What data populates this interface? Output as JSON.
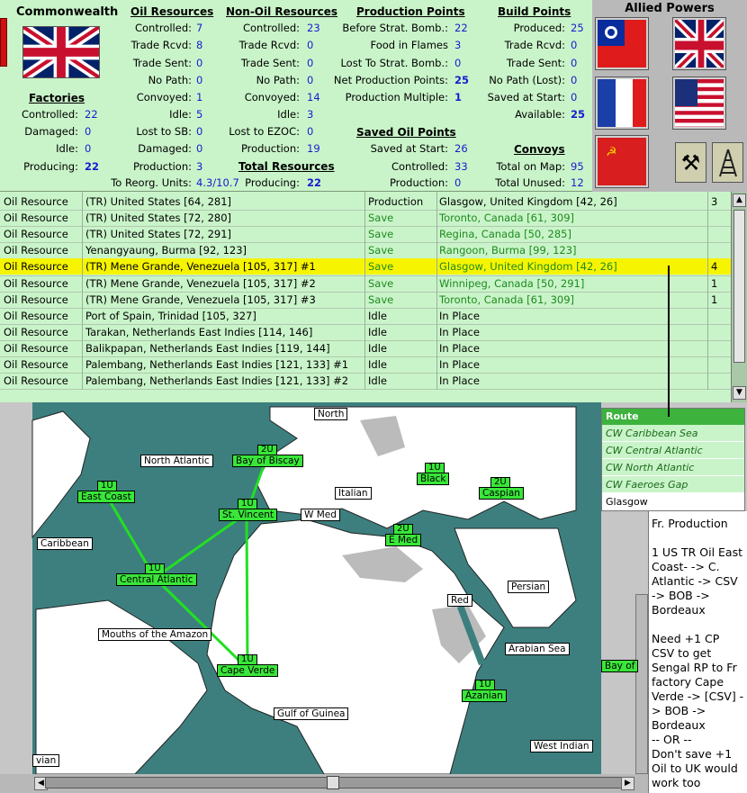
{
  "commonwealth": {
    "title": "Commonwealth"
  },
  "oil": {
    "heading": "Oil Resources",
    "controlled_l": "Controlled:",
    "controlled": "7",
    "trade_rcvd_l": "Trade Rcvd:",
    "trade_rcvd": "8",
    "trade_sent_l": "Trade Sent:",
    "trade_sent": "0",
    "no_path_l": "No Path:",
    "no_path": "0",
    "convoyed_l": "Convoyed:",
    "convoyed": "1",
    "idle_l": "Idle:",
    "idle": "5",
    "lost_sb_l": "Lost to SB:",
    "lost_sb": "0",
    "damaged_l": "Damaged:",
    "damaged": "0",
    "production_l": "Production:",
    "production": "3"
  },
  "factories": {
    "heading": "Factories",
    "controlled_l": "Controlled:",
    "controlled": "22",
    "damaged_l": "Damaged:",
    "damaged": "0",
    "idle_l": "Idle:",
    "idle": "0",
    "producing_l": "Producing:",
    "producing": "22"
  },
  "nonoil": {
    "heading": "Non-Oil Resources",
    "controlled_l": "Controlled:",
    "controlled": "23",
    "trade_rcvd_l": "Trade Rcvd:",
    "trade_rcvd": "0",
    "trade_sent_l": "Trade Sent:",
    "trade_sent": "0",
    "no_path_l": "No Path:",
    "no_path": "0",
    "convoyed_l": "Convoyed:",
    "convoyed": "14",
    "idle_l": "Idle:",
    "idle": "3",
    "lost_ezoc_l": "Lost to EZOC:",
    "lost_ezoc": "0",
    "production_l": "Production:",
    "production": "19"
  },
  "total": {
    "heading": "Total Resources",
    "reorg_l": "To Reorg. Units:",
    "reorg": "4.3/10.7",
    "producing_l": "Producing:",
    "producing": "22"
  },
  "pp": {
    "heading": "Production Points",
    "before_l": "Before Strat. Bomb.:",
    "before": "22",
    "food_l": "Food in Flames",
    "food": "3",
    "lost_l": "Lost To Strat. Bomb.:",
    "lost": "0",
    "net_l": "Net Production Points:",
    "net": "25",
    "mult_l": "Production Multiple:",
    "mult": "1"
  },
  "saved": {
    "heading": "Saved Oil Points",
    "start_l": "Saved at Start:",
    "start": "26",
    "controlled_l": "Controlled:",
    "controlled": "33",
    "production_l": "Production:",
    "production": "0"
  },
  "bp": {
    "heading": "Build Points",
    "produced_l": "Produced:",
    "produced": "25",
    "trade_rcvd_l": "Trade Rcvd:",
    "trade_rcvd": "0",
    "trade_sent_l": "Trade Sent:",
    "trade_sent": "0",
    "no_path_l": "No Path (Lost):",
    "no_path": "0",
    "saved_l": "Saved at Start:",
    "saved": "0",
    "available_l": "Available:",
    "available": "25"
  },
  "convoys": {
    "heading": "Convoys",
    "total_l": "Total on Map:",
    "total": "95",
    "unused_l": "Total Unused:",
    "unused": "12"
  },
  "allied": {
    "title": "Allied Powers"
  },
  "colors": {
    "panel_bg": "#c9f4c9",
    "value_blue": "#1a1ad0",
    "selected_row": "#f6f400",
    "save_green": "#1f8a1f",
    "sea": "#3d7f7f",
    "unit_green": "#39e639"
  },
  "rows": [
    {
      "type": "Oil Resource",
      "resource": "(TR) United States [64, 281]",
      "status": "Production",
      "dest": "Glasgow, United Kingdom [42, 26]",
      "num": "3",
      "save": false,
      "sel": false
    },
    {
      "type": "Oil Resource",
      "resource": "(TR) United States [72, 280]",
      "status": "Save",
      "dest": "Toronto, Canada [61, 309]",
      "num": "",
      "save": true,
      "sel": false
    },
    {
      "type": "Oil Resource",
      "resource": "(TR) United States [72, 291]",
      "status": "Save",
      "dest": "Regina, Canada [50, 285]",
      "num": "",
      "save": true,
      "sel": false
    },
    {
      "type": "Oil Resource",
      "resource": "Yenangyaung, Burma [92, 123]",
      "status": "Save",
      "dest": "Rangoon, Burma [99, 123]",
      "num": "",
      "save": true,
      "sel": false
    },
    {
      "type": "Oil Resource",
      "resource": "(TR) Mene Grande, Venezuela [105, 317] #1",
      "status": "Save",
      "dest": "Glasgow, United Kingdom [42, 26]",
      "num": "4",
      "save": true,
      "sel": true
    },
    {
      "type": "Oil Resource",
      "resource": "(TR) Mene Grande, Venezuela [105, 317] #2",
      "status": "Save",
      "dest": "Winnipeg, Canada [50, 291]",
      "num": "1",
      "save": true,
      "sel": false
    },
    {
      "type": "Oil Resource",
      "resource": "(TR) Mene Grande, Venezuela [105, 317] #3",
      "status": "Save",
      "dest": "Toronto, Canada [61, 309]",
      "num": "1",
      "save": true,
      "sel": false
    },
    {
      "type": "Oil Resource",
      "resource": "Port of Spain, Trinidad [105, 327]",
      "status": "Idle",
      "dest": "In Place",
      "num": "",
      "save": false,
      "sel": false
    },
    {
      "type": "Oil Resource",
      "resource": "Tarakan, Netherlands East Indies [114, 146]",
      "status": "Idle",
      "dest": "In Place",
      "num": "",
      "save": false,
      "sel": false
    },
    {
      "type": "Oil Resource",
      "resource": "Balikpapan, Netherlands East Indies [119, 144]",
      "status": "Idle",
      "dest": "In Place",
      "num": "",
      "save": false,
      "sel": false
    },
    {
      "type": "Oil Resource",
      "resource": "Palembang, Netherlands East Indies [121, 133] #1",
      "status": "Idle",
      "dest": "In Place",
      "num": "",
      "save": false,
      "sel": false
    },
    {
      "type": "Oil Resource",
      "resource": "Palembang, Netherlands East Indies [121, 133] #2",
      "status": "Idle",
      "dest": "In Place",
      "num": "",
      "save": false,
      "sel": false
    }
  ],
  "route": {
    "title": "Route",
    "items": [
      "CW Caribbean Sea",
      "CW Central Atlantic",
      "CW North Atlantic",
      "CW Faeroes Gap",
      "Glasgow"
    ]
  },
  "notes": "Fr. Production\n\n1 US TR Oil East Coast- -> C. Atlantic -> CSV -> BOB -> Bordeaux\n\nNeed +1 CP CSV to get Sengal RP to Fr factory Cape Verde -> [CSV] -> BOB -> Bordeaux\n-- OR --\nDon't save +1 Oil to UK would work too",
  "map": {
    "sea_labels": [
      "North",
      "North Atlantic",
      "Italian",
      "W Med",
      "Caribbean",
      "Persian",
      "Red",
      "Mouths of the Amazon",
      "Arabian Sea",
      "Gulf of Guinea",
      "West Indian",
      "vian",
      "Bay of"
    ],
    "zones": [
      "Bay of Biscay",
      "East Coast",
      "St. Vincent",
      "Central Atlantic",
      "Cape Verde",
      "E Med",
      "Black",
      "Caspian",
      "Azanian"
    ],
    "units": [
      "2U",
      "1U",
      "1U",
      "1U",
      "1U",
      "2U",
      "1U",
      "2U",
      "1U"
    ]
  }
}
